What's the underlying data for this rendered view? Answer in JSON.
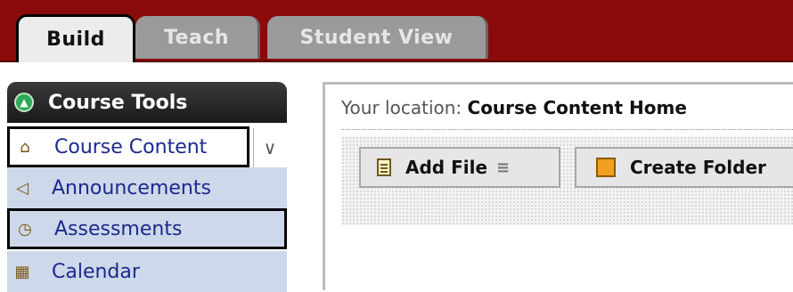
{
  "tabs": {
    "build": "Build",
    "teach": "Teach",
    "student_view": "Student View"
  },
  "course_tools": {
    "header": "Course Tools",
    "items": [
      {
        "label": "Course Content",
        "icon": "home-icon"
      },
      {
        "label": "Announcements",
        "icon": "megaphone-icon"
      },
      {
        "label": "Assessments",
        "icon": "clipboard-clock-icon"
      },
      {
        "label": "Calendar",
        "icon": "calendar-icon"
      }
    ],
    "expand_icon": "double-chevron-down-icon"
  },
  "location": {
    "prefix": "Your location:",
    "value": "Course Content Home"
  },
  "toolbar": {
    "add_file": "Add File",
    "create_folder": "Create Folder"
  }
}
